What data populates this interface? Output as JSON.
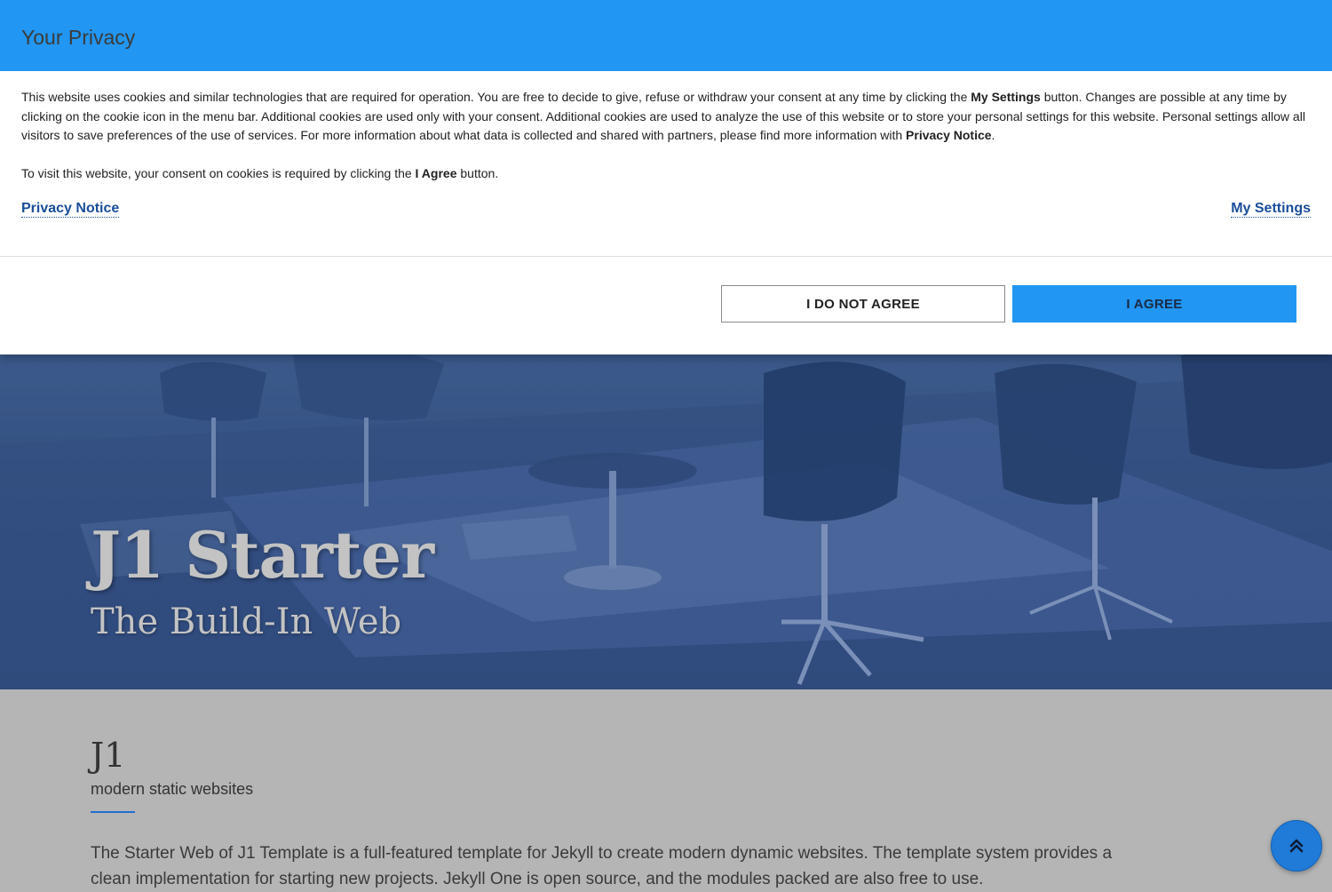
{
  "modal": {
    "title": "Your Privacy",
    "para1": {
      "t1": "This website uses cookies and similar technologies that are required for operation. You are free to decide to give, refuse or withdraw your consent at any time by clicking the ",
      "b1": "My Settings",
      "t2": " button. Changes are possible at any time by clicking on the cookie icon in the menu bar. Additional cookies are used only with your consent. Additional cookies are used to analyze the use of this website or to store your personal settings for this website. Personal settings allow all visitors to save preferences of the use of services. For more information about what data is collected and shared with partners, please find more information with ",
      "b2": "Privacy Notice",
      "t3": "."
    },
    "para2": {
      "t1": "To visit this website, your consent on cookies is required by clicking the ",
      "b1": "I Agree",
      "t2": " button."
    },
    "privacy_link": "Privacy Notice",
    "settings_link": "My Settings",
    "disagree_button": "I DO NOT AGREE",
    "agree_button": "I AGREE",
    "colors": {
      "header": "#2196f3",
      "agree": "#2196f3",
      "link": "#1a4e9a"
    }
  },
  "hero": {
    "title": "J1 Starter",
    "subtitle": "The Build-In Web"
  },
  "content": {
    "heading": "J1",
    "tagline": "modern static websites",
    "text": "The Starter Web of J1 Template is a full-featured template for Jekyll to create modern dynamic websites. The template system provides a clean implementation for starting new projects. Jekyll One is open source, and the modules packed are also free to use."
  },
  "scroll_top": {
    "icon": "double-chevron-up-icon"
  }
}
